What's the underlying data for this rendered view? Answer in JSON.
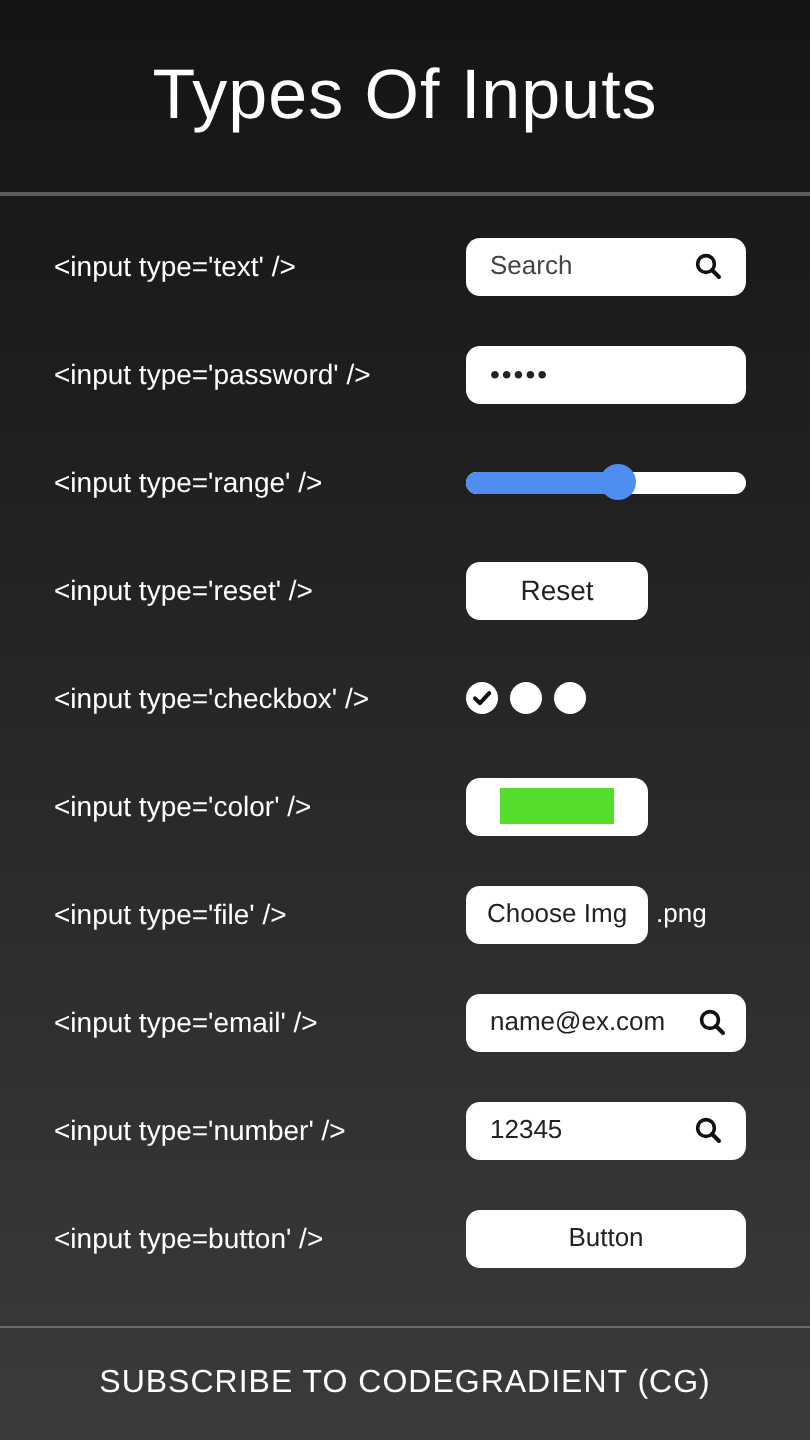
{
  "title": "Types Of Inputs",
  "rows": [
    {
      "label": "<input type='text' />",
      "control": {
        "kind": "text",
        "placeholder": "Search",
        "icon": true
      }
    },
    {
      "label": "<input type='password' />",
      "control": {
        "kind": "password",
        "value": "•••••"
      }
    },
    {
      "label": "<input type='range' />",
      "control": {
        "kind": "range",
        "level": 0.54
      }
    },
    {
      "label": "<input type='reset' />",
      "control": {
        "kind": "reset",
        "label": "Reset"
      }
    },
    {
      "label": "<input type='checkbox' />",
      "control": {
        "kind": "checkbox",
        "boxes": [
          {
            "checked": true
          },
          {
            "checked": false
          },
          {
            "checked": false
          }
        ]
      }
    },
    {
      "label": "<input type='color' />",
      "control": {
        "kind": "color",
        "color": "#55dd2c"
      }
    },
    {
      "label": "<input type='file' />",
      "control": {
        "kind": "file",
        "label": "Choose Img",
        "suffix": ".png"
      }
    },
    {
      "label": "<input type='email' />",
      "control": {
        "kind": "text",
        "value": "name@ex.com",
        "icon": true
      }
    },
    {
      "label": "<input type='number' />",
      "control": {
        "kind": "text",
        "value": "12345",
        "icon": true
      }
    },
    {
      "label": "<input type=button' />",
      "control": {
        "kind": "button",
        "label": "Button"
      }
    }
  ],
  "footer": "SUBSCRIBE TO CODEGRADIENT (CG)"
}
